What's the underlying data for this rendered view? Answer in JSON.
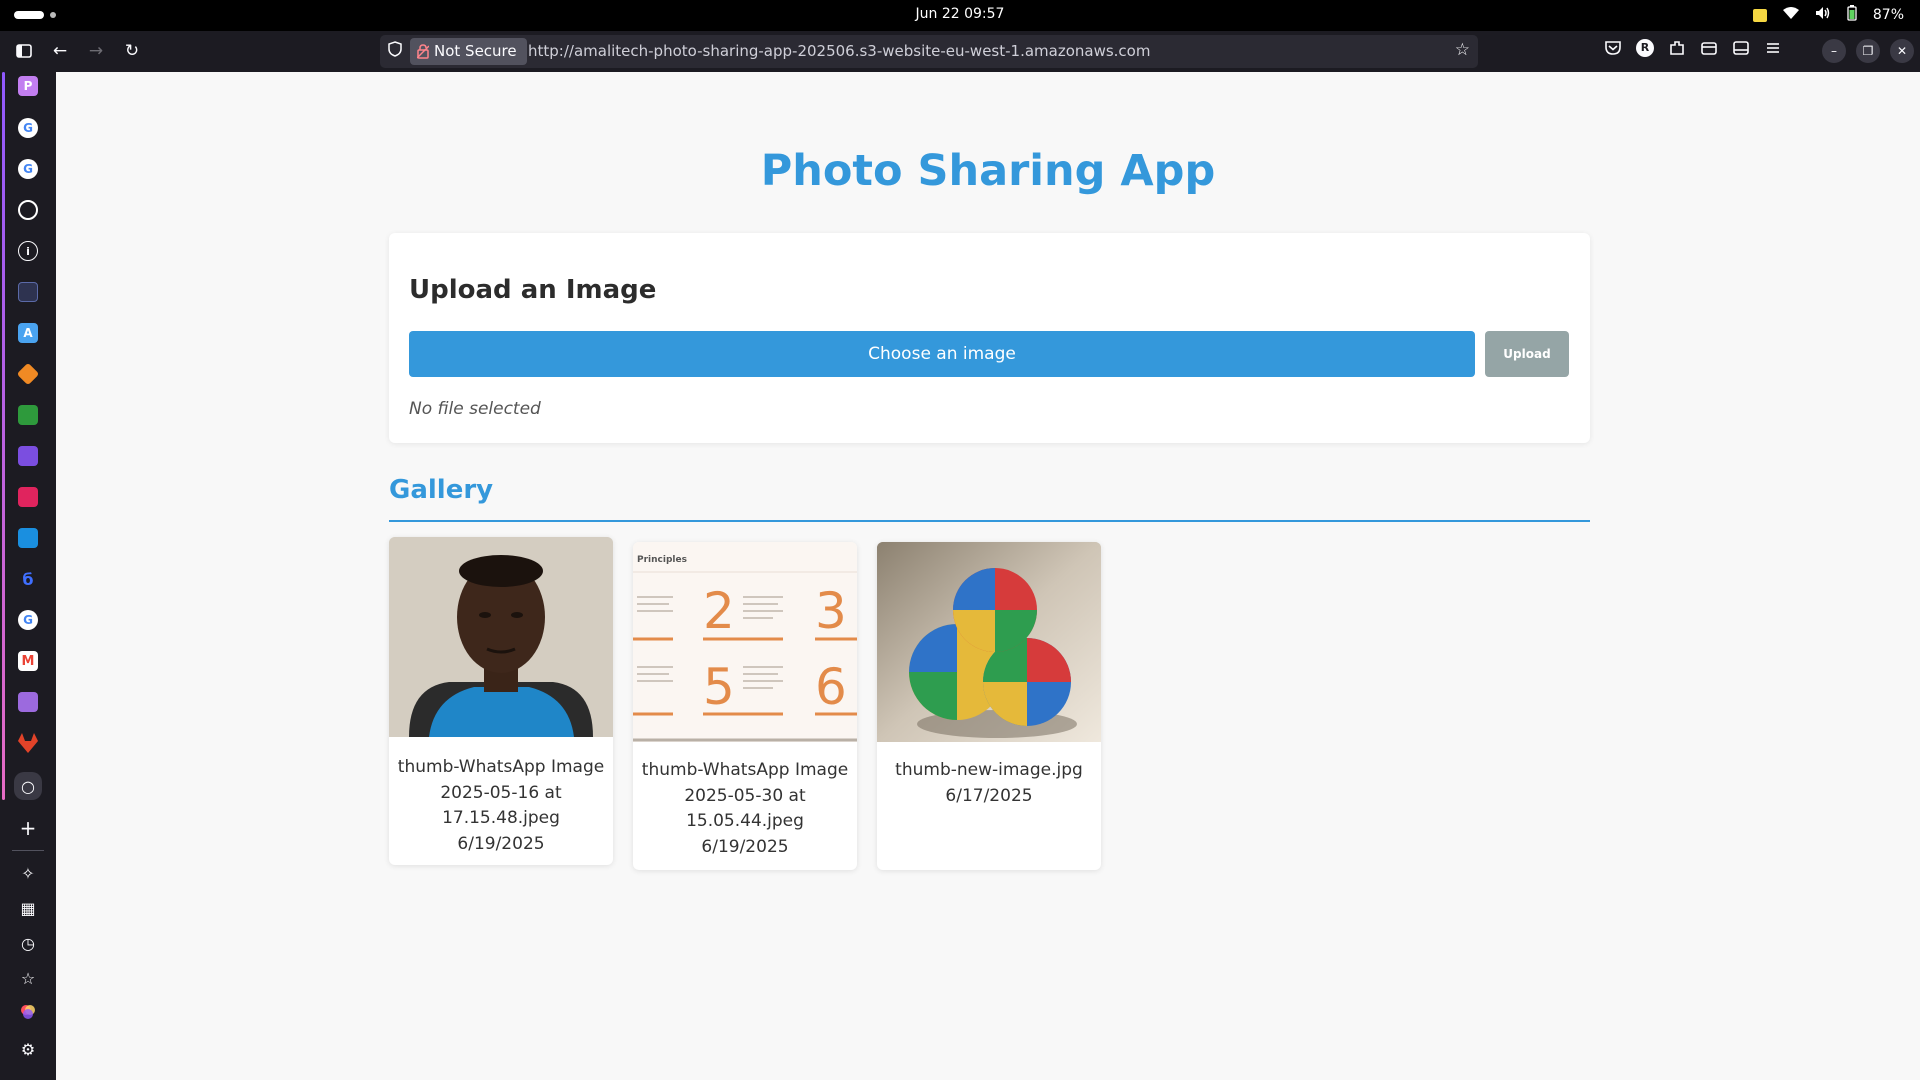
{
  "os": {
    "clock": "Jun 22  09:57",
    "battery": "87%"
  },
  "browser": {
    "security_label": "Not Secure",
    "url": "http://amalitech-photo-sharing-app-202506.s3-website-eu-west-1.amazonaws.com",
    "extension_badge": "R"
  },
  "sidebar": {
    "top_icon_letter": "P",
    "app_icon_letter": "A"
  },
  "page": {
    "title": "Photo Sharing App",
    "upload": {
      "heading": "Upload an Image",
      "choose_label": "Choose an image",
      "upload_label": "Upload",
      "status": "No file selected"
    },
    "gallery": {
      "heading": "Gallery",
      "items": [
        {
          "name_line1": "thumb-WhatsApp Image",
          "name_line2": "2025-05-16 at",
          "name_line3": "17.15.48.jpeg",
          "date": "6/19/2025"
        },
        {
          "name_line1": "thumb-WhatsApp Image",
          "name_line2": "2025-05-30 at",
          "name_line3": "15.05.44.jpeg",
          "date": "6/19/2025",
          "thumb_text": {
            "heading": "Principles",
            "n1": "2",
            "n2": "3",
            "n3": "5",
            "n4": "6"
          }
        },
        {
          "name_line1": "thumb-new-image.jpg",
          "date": "6/17/2025"
        }
      ]
    }
  },
  "colors": {
    "accent": "#3498db",
    "upload_disabled": "#95a5a6"
  }
}
